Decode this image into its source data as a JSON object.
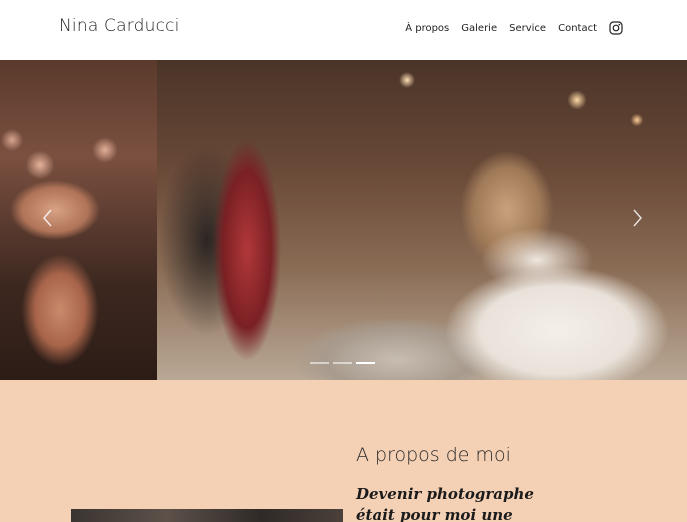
{
  "header": {
    "brand": "Nina Carducci",
    "nav": [
      "À propos",
      "Galerie",
      "Service",
      "Contact"
    ],
    "social_icon": "instagram-icon"
  },
  "hero": {
    "slides_count": 3,
    "active_slide": 3,
    "prev_icon": "chevron-left-icon",
    "next_icon": "chevron-right-icon"
  },
  "about": {
    "title": "A propos de moi",
    "subtitle": "Devenir photographe était pour moi une"
  },
  "colors": {
    "about_bg": "#f4d0b5",
    "header_bg": "#ffffff"
  }
}
